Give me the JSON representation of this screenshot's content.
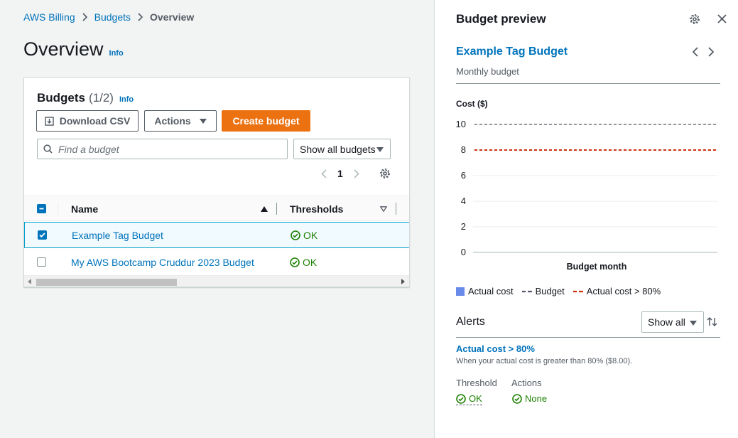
{
  "breadcrumb": {
    "items": [
      "AWS Billing",
      "Budgets"
    ],
    "current": "Overview"
  },
  "page": {
    "title": "Overview",
    "info": "Info"
  },
  "budgets_card": {
    "title": "Budgets",
    "count": "(1/2)",
    "info": "Info",
    "download_csv": "Download CSV",
    "actions": "Actions",
    "create_budget": "Create budget",
    "search_placeholder": "Find a budget",
    "filter_select": "Show all budgets",
    "current_page": "1",
    "columns": {
      "name": "Name",
      "thresholds": "Thresholds"
    },
    "rows": [
      {
        "name": "Example Tag Budget",
        "status": "OK",
        "selected": true
      },
      {
        "name": "My AWS Bootcamp Cruddur 2023 Budget",
        "status": "OK",
        "selected": false
      }
    ]
  },
  "preview": {
    "title": "Budget preview",
    "budget_name": "Example Tag Budget",
    "budget_type": "Monthly budget",
    "cost_label": "Cost ($)",
    "alerts_title": "Alerts",
    "alerts_filter": "Show all",
    "alert_name": "Actual cost > 80%",
    "alert_desc": "When your actual cost is greater than 80% ($8.00).",
    "threshold_label": "Threshold",
    "threshold_value": "OK",
    "actions_label": "Actions",
    "actions_value": "None"
  },
  "chart_data": {
    "type": "line",
    "title": "",
    "xlabel": "Budget month",
    "ylabel": "Cost ($)",
    "ylim": [
      0,
      10
    ],
    "yticks": [
      0,
      2,
      4,
      6,
      8,
      10
    ],
    "grid": true,
    "legend_placement": "bottom",
    "series": [
      {
        "name": "Actual cost",
        "values": [],
        "color": "#688ae8"
      },
      {
        "name": "Budget",
        "values": [
          10
        ],
        "color": "#545b64"
      },
      {
        "name": "Actual cost > 80%",
        "values": [
          8
        ],
        "color": "#d13212"
      }
    ]
  },
  "colors": {
    "accent": "#0073bb",
    "primary_button": "#ec7211",
    "success": "#1d8102"
  }
}
